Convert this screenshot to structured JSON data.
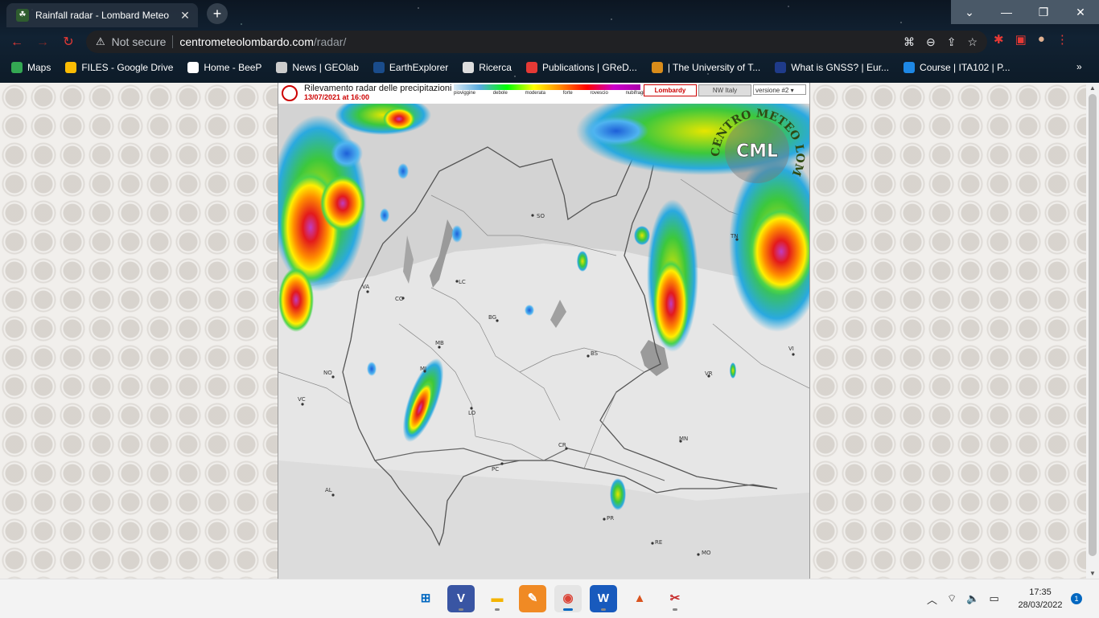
{
  "browser": {
    "tab_title": "Rainfall radar - Lombard Meteo",
    "address": {
      "security_label": "Not secure",
      "host": "centrometeolombardo.com",
      "path": "/radar/"
    },
    "bookmarks": [
      {
        "label": "Maps",
        "icon": "maps-icon",
        "color": "#34a853"
      },
      {
        "label": "FILES - Google Drive",
        "icon": "drive-icon",
        "color": "#fbbc04"
      },
      {
        "label": "Home - BeeP",
        "icon": "page-icon",
        "color": "#ffffff"
      },
      {
        "label": "News | GEOlab",
        "icon": "wordpress-icon",
        "color": "#cccccc"
      },
      {
        "label": "EarthExplorer",
        "icon": "ee-icon",
        "color": "#1a4c8b"
      },
      {
        "label": "Ricerca",
        "icon": "ricerca-icon",
        "color": "#dddddd"
      },
      {
        "label": "Publications | GReD...",
        "icon": "g-icon",
        "color": "#e53935"
      },
      {
        "label": "| The University of T...",
        "icon": "ut-icon",
        "color": "#d98c1a"
      },
      {
        "label": "What is GNSS? | Eur...",
        "icon": "eu-icon",
        "color": "#1f3b8a"
      },
      {
        "label": "Course | ITA102 | P...",
        "icon": "pdf-icon",
        "color": "#1e88e5"
      }
    ],
    "bookmarks_more": "»"
  },
  "radar": {
    "title": "Rilevamento radar delle precipitazioni",
    "timestamp": "13/07/2021 at 16:00",
    "legend": [
      "pioviggine",
      "debole",
      "moderata",
      "forte",
      "rovescio",
      "nubifragio"
    ],
    "region_lombardy": "Lombardy",
    "region_nw": "NW Italy",
    "version": "versione #2",
    "logo_text": "CENTRO METEO LOMBARDO",
    "logo_abbr": "CML",
    "cities": [
      "SO",
      "VA",
      "CO",
      "LC",
      "TN",
      "BG",
      "BS",
      "MB",
      "MI",
      "NO",
      "VR",
      "VI",
      "VC",
      "LO",
      "CR",
      "MN",
      "PC",
      "AL",
      "PR",
      "RE",
      "MO"
    ]
  },
  "taskbar": {
    "apps": [
      {
        "name": "start",
        "icon": "windows-icon"
      },
      {
        "name": "visio",
        "icon": "visio-icon"
      },
      {
        "name": "explorer",
        "icon": "folder-icon"
      },
      {
        "name": "pdf",
        "icon": "pdf-editor-icon"
      },
      {
        "name": "chrome",
        "icon": "chrome-icon"
      },
      {
        "name": "word",
        "icon": "word-icon"
      },
      {
        "name": "matlab",
        "icon": "matlab-icon"
      },
      {
        "name": "snipping",
        "icon": "snip-icon"
      }
    ],
    "time": "17:35",
    "date": "28/03/2022",
    "notifications": "1"
  }
}
